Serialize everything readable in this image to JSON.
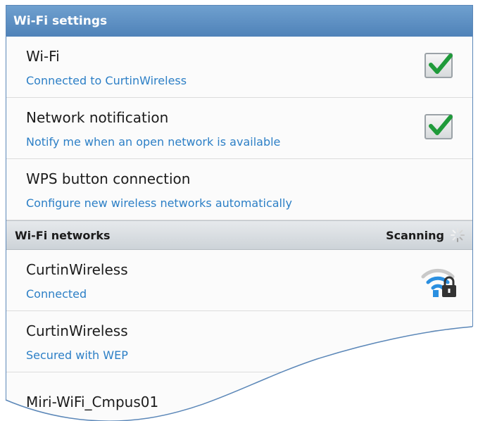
{
  "header": {
    "title": "Wi-Fi settings"
  },
  "settings": [
    {
      "title": "Wi-Fi",
      "subtitle": "Connected to CurtinWireless",
      "checked": true
    },
    {
      "title": "Network notification",
      "subtitle": "Notify me when an open network is available",
      "checked": true
    },
    {
      "title": "WPS button connection",
      "subtitle": "Configure new wireless networks automatically"
    }
  ],
  "networks_section": {
    "label": "Wi-Fi networks",
    "status": "Scanning"
  },
  "networks": [
    {
      "name": "CurtinWireless",
      "status": "Connected",
      "icon": "wifi-lock-icon"
    },
    {
      "name": "CurtinWireless",
      "status": "Secured with WEP",
      "icon": "wifi-lock-icon"
    },
    {
      "name": "Miri-WiFi_Cmpus01"
    }
  ],
  "colors": {
    "header": "#5b8dc2",
    "accent_text": "#2c7fc6",
    "check": "#1f9a3a",
    "wifi_blue": "#2a8fe0"
  }
}
